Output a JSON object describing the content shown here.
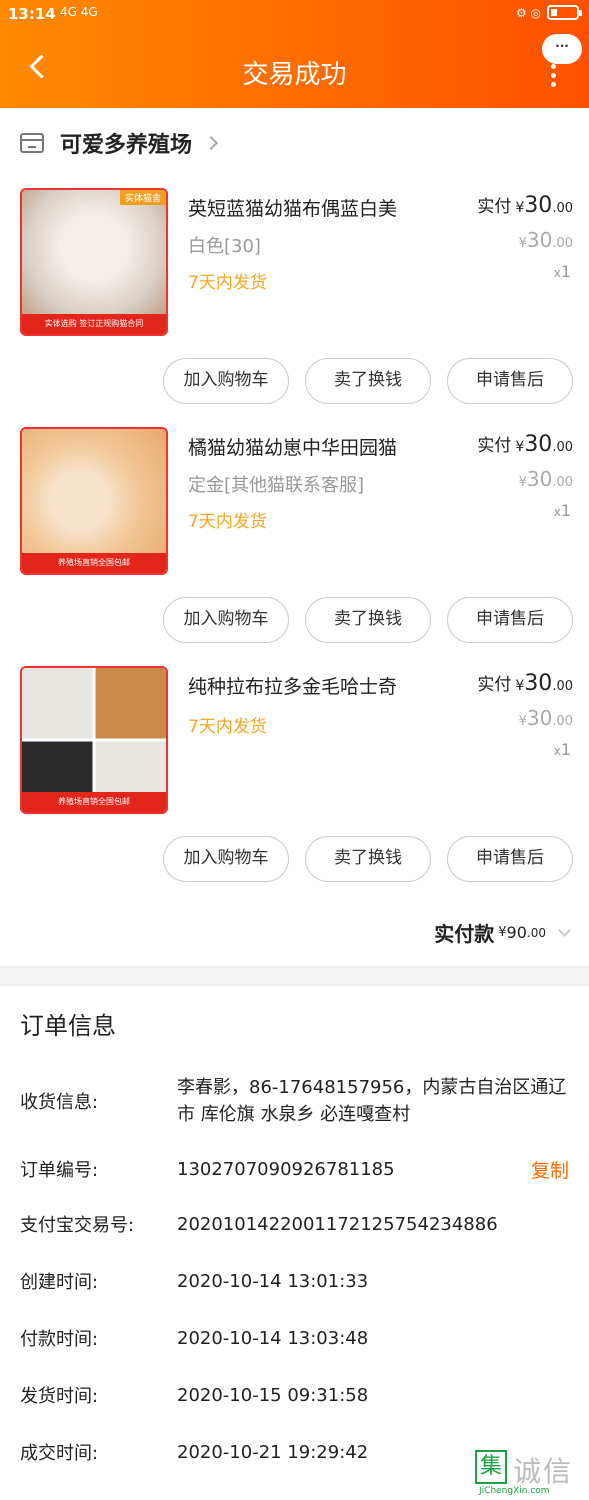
{
  "status_bar": {
    "time": "13:14",
    "signal": "4G 4G",
    "net": "HD",
    "right": "⚙ ◎"
  },
  "header": {
    "title": "交易成功",
    "more_bubble": "···"
  },
  "shop": {
    "name": "可爱多养殖场"
  },
  "labels": {
    "paid_prefix": "实付",
    "currency": "¥",
    "qty_prefix": "x"
  },
  "items": [
    {
      "name": "英短蓝猫幼猫布偶蓝白美",
      "sku": "白色[30]",
      "shipping": "7天内发货",
      "paid_int": "30",
      "paid_dec": ".00",
      "orig_int": "30",
      "orig_dec": ".00",
      "qty": "1",
      "image_tag": "实体猫舍",
      "image_band": "实体选购 签订正规购猫合同",
      "buttons": [
        "加入购物车",
        "卖了换钱",
        "申请售后"
      ],
      "image_colors": [
        "#d9cfc6",
        "#f3eee9",
        "#b88a6a"
      ]
    },
    {
      "name": "橘猫幼猫幼崽中华田园猫",
      "sku": "定金[其他猫联系客服]",
      "shipping": "7天内发货",
      "paid_int": "30",
      "paid_dec": ".00",
      "orig_int": "30",
      "orig_dec": ".00",
      "qty": "1",
      "image_tag": "",
      "image_band": "养殖场直销全国包邮",
      "buttons": [
        "加入购物车",
        "卖了换钱",
        "申请售后"
      ],
      "image_colors": [
        "#f2c99a",
        "#e9a86a",
        "#f7e3cc"
      ]
    },
    {
      "name": "纯种拉布拉多金毛哈士奇",
      "sku": "",
      "shipping": "7天内发货",
      "paid_int": "30",
      "paid_dec": ".00",
      "orig_int": "30",
      "orig_dec": ".00",
      "qty": "1",
      "image_tag": "",
      "image_band": "养殖场直销全国包邮",
      "buttons": [
        "加入购物车",
        "卖了换钱",
        "申请售后"
      ],
      "image_colors": [
        "#e8e6e0",
        "#c98a4a",
        "#2b2b2b"
      ]
    }
  ],
  "total": {
    "label": "实付款",
    "currency": "¥",
    "int": "90",
    "dec": ".00"
  },
  "order_info": {
    "title": "订单信息",
    "rows": [
      {
        "label": "收货信息:",
        "value": "李春影，86-17648157956，内蒙古自治区通辽市 库伦旗 水泉乡 必连嘎查村"
      },
      {
        "label": "订单编号:",
        "value": "1302707090926781185",
        "action": "复制"
      },
      {
        "label": "支付宝交易号:",
        "value": "2020101422001172125754234886"
      },
      {
        "label": "创建时间:",
        "value": "2020-10-14 13:01:33"
      },
      {
        "label": "付款时间:",
        "value": "2020-10-14 13:03:48"
      },
      {
        "label": "发货时间:",
        "value": "2020-10-15 09:31:58"
      },
      {
        "label": "成交时间:",
        "value": "2020-10-21 19:29:42"
      }
    ]
  },
  "watermark": {
    "box": "集",
    "cn": "诚信",
    "en": "JiChengXin.com"
  }
}
